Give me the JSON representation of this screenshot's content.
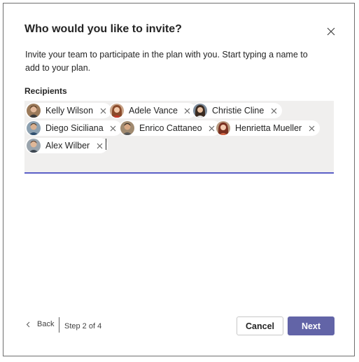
{
  "dialog": {
    "title": "Who would you like to invite?",
    "description": "Invite your team to participate in the plan with you. Start typing a name to add to your plan.",
    "recipients_label": "Recipients",
    "input_value": "",
    "recipients": [
      {
        "name": "Kelly Wilson",
        "avatar": "avatar-kelly-wilson"
      },
      {
        "name": "Adele Vance",
        "avatar": "avatar-adele-vance"
      },
      {
        "name": "Christie Cline",
        "avatar": "avatar-christie-cline"
      },
      {
        "name": "Diego Siciliana",
        "avatar": "avatar-diego-siciliana"
      },
      {
        "name": "Enrico Cattaneo",
        "avatar": "avatar-enrico-cattaneo"
      },
      {
        "name": "Henrietta Mueller",
        "avatar": "avatar-henrietta-mueller"
      },
      {
        "name": "Alex Wilber",
        "avatar": "avatar-alex-wilber"
      }
    ]
  },
  "footer": {
    "back_label": "Back",
    "step_text": "Step 2 of 4",
    "cancel_label": "Cancel",
    "next_label": "Next"
  },
  "colors": {
    "accent": "#6264a7",
    "field_background": "#f0efee",
    "field_underline": "#5b5fc7"
  }
}
